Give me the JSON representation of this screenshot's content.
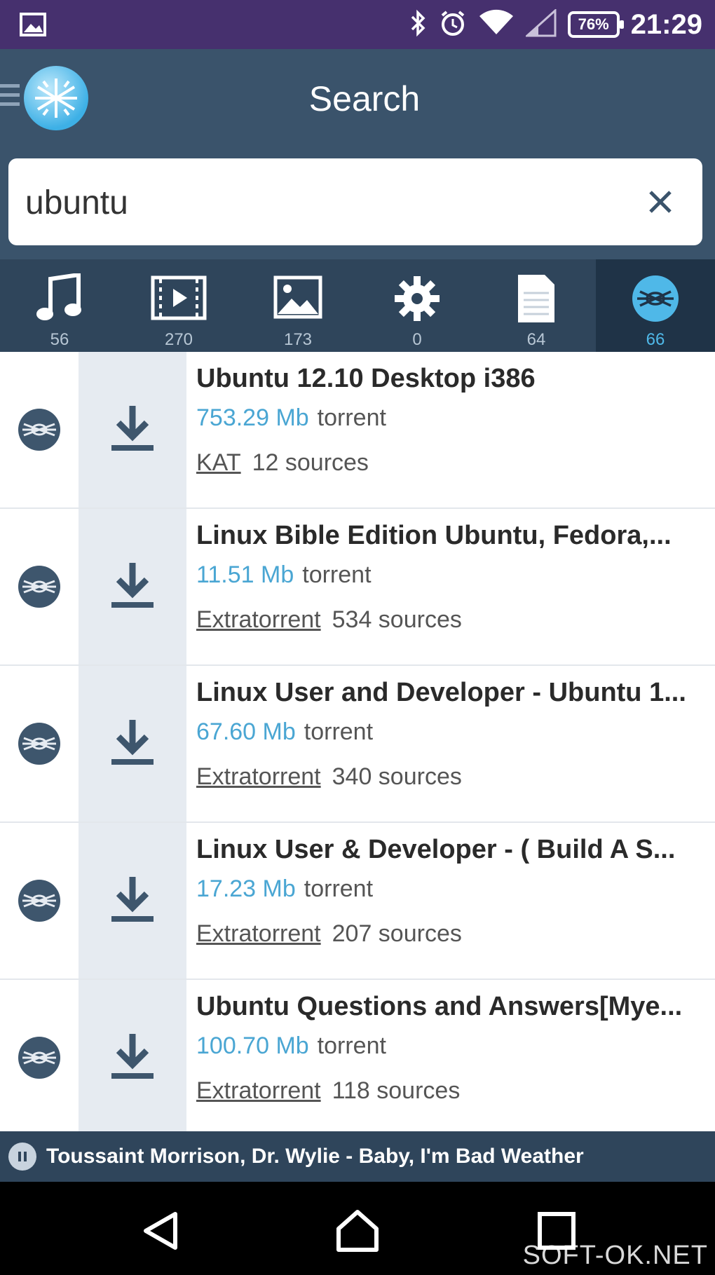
{
  "status_bar": {
    "battery": "76%",
    "time": "21:29",
    "icons": [
      "image-icon",
      "bluetooth-icon",
      "alarm-icon",
      "wifi-icon",
      "signal-icon",
      "battery-icon"
    ]
  },
  "app_bar": {
    "title": "Search",
    "menu_icon": "hamburger-icon",
    "logo_icon": "app-logo-icon"
  },
  "search": {
    "value": "ubuntu",
    "clear_icon": "close-icon"
  },
  "tabs": [
    {
      "icon": "music-icon",
      "count": "56"
    },
    {
      "icon": "video-icon",
      "count": "270"
    },
    {
      "icon": "image-icon",
      "count": "173"
    },
    {
      "icon": "apps-icon",
      "count": "0"
    },
    {
      "icon": "document-icon",
      "count": "64"
    },
    {
      "icon": "torrent-icon",
      "count": "66",
      "active": true
    }
  ],
  "results": [
    {
      "name": "Ubuntu 12.10 Desktop i386",
      "size": "753.29 Mb",
      "type": "torrent",
      "source": "KAT",
      "sources": "12 sources"
    },
    {
      "name": "Linux Bible Edition Ubuntu, Fedora,...",
      "size": "11.51 Mb",
      "type": "torrent",
      "source": "Extratorrent",
      "sources": "534 sources"
    },
    {
      "name": "Linux User and Developer - Ubuntu 1...",
      "size": "67.60 Mb",
      "type": "torrent",
      "source": "Extratorrent",
      "sources": "340 sources"
    },
    {
      "name": "Linux User & Developer - ( Build A S...",
      "size": "17.23 Mb",
      "type": "torrent",
      "source": "Extratorrent",
      "sources": "207 sources"
    },
    {
      "name": "Ubuntu Questions and Answers[Mye...",
      "size": "100.70 Mb",
      "type": "torrent",
      "source": "Extratorrent",
      "sources": "118 sources"
    }
  ],
  "now_playing": {
    "text": "Toussaint Morrison, Dr. Wylie - Baby, I'm Bad Weather"
  },
  "nav_bar": {
    "icons": [
      "back-icon",
      "home-icon",
      "recents-icon"
    ]
  },
  "watermark": "SOFT-OK.NET",
  "colors": {
    "status_bar": "#46306e",
    "app_bar": "#3a536b",
    "tab_bar": "#2f455b",
    "accent": "#4aa6d3"
  }
}
